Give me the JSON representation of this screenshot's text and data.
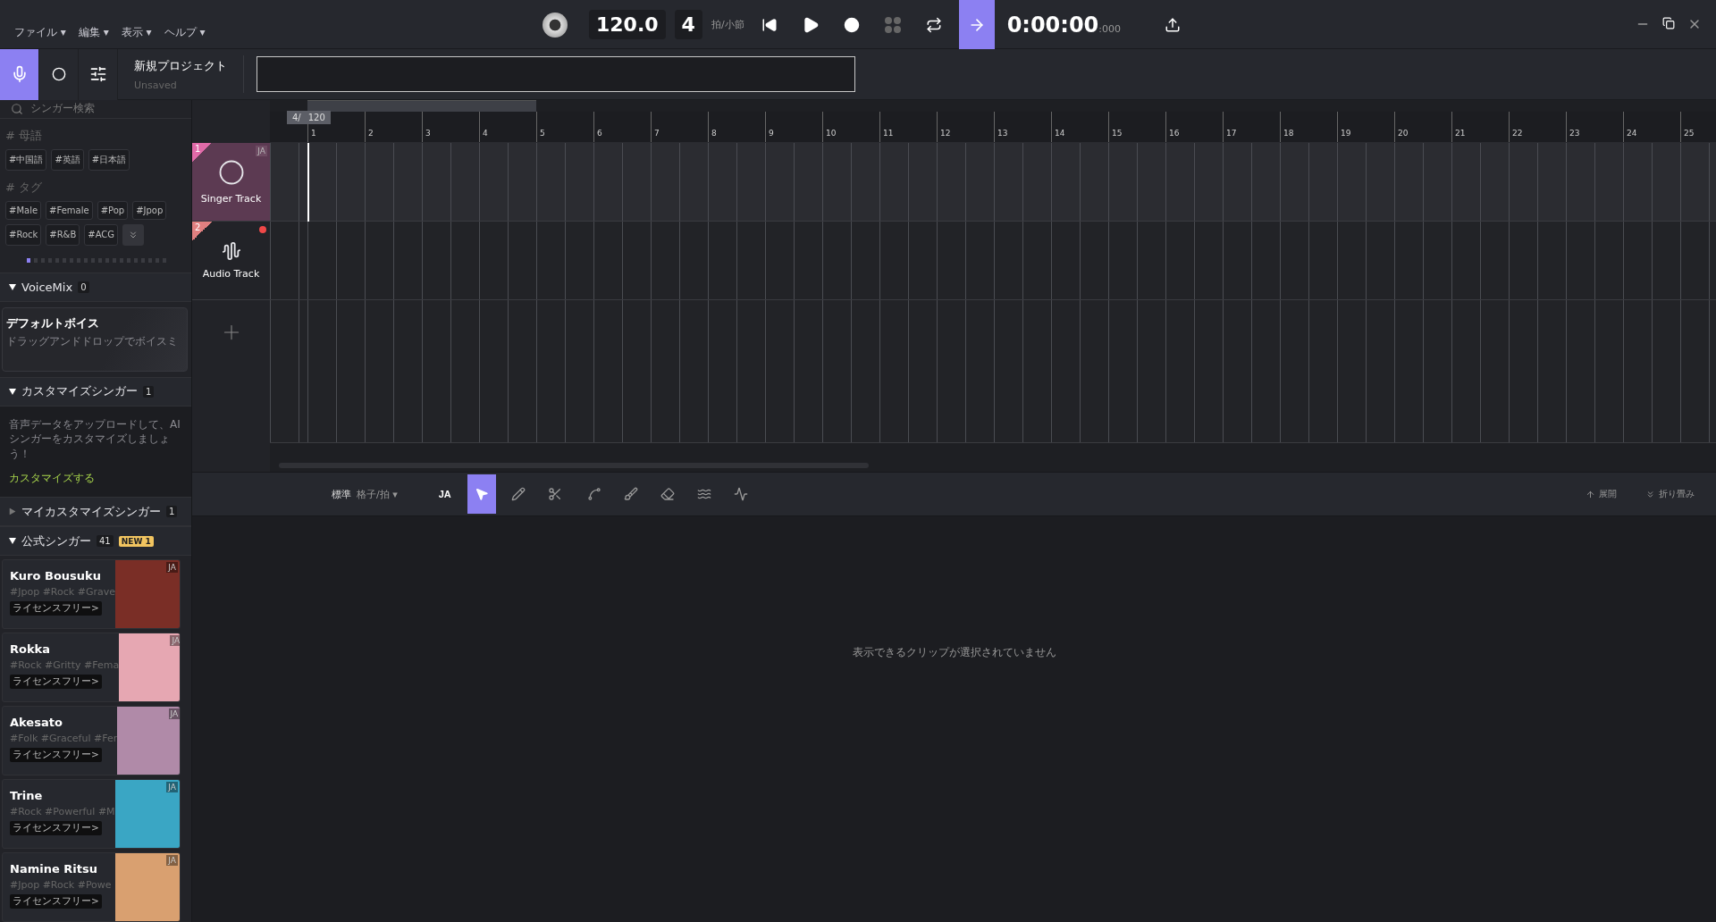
{
  "menu": [
    {
      "label": "ファイル",
      "caret": "▾"
    },
    {
      "label": "編集",
      "caret": "▾"
    },
    {
      "label": "表示",
      "caret": "▾"
    },
    {
      "label": "ヘルプ",
      "caret": "▾"
    }
  ],
  "transport": {
    "tempo": "120.0",
    "beats": "4",
    "beats_unit": "拍/小節",
    "time": "0:00:00",
    "time_ms": ":000",
    "follow_on": true
  },
  "sidebar_tabs": [
    {
      "kind": "microphone",
      "selected": true
    },
    {
      "kind": "avatar",
      "selected": false
    },
    {
      "kind": "sliders",
      "selected": false
    }
  ],
  "project": {
    "name": "新規プロジェクト",
    "status": "Unsaved"
  },
  "sidebar": {
    "search": {
      "placeholder": "シンガー検索"
    },
    "language_heading": "# 母語",
    "languages": [
      "#中国語",
      "#英語",
      "#日本語"
    ],
    "tag_heading": "# タグ",
    "tags": [
      "#Male",
      "#Female",
      "#Pop",
      "#Jpop",
      "#Rock",
      "#R&B",
      "#ACG"
    ],
    "sections": [
      {
        "kind": "voicemix",
        "title": "VoiceMix",
        "count": "0",
        "expanded": true,
        "card": {
          "title": "デフォルトボイス",
          "text": "ドラッグアンドドロップでボイスミ"
        }
      },
      {
        "kind": "custom",
        "title": "カスタマイズシンガー",
        "count": "1",
        "expanded": true,
        "text": "音声データをアップロードして、AIシンガーをカスタマイズしましょう！",
        "link": "カスタマイズする"
      },
      {
        "kind": "mine",
        "title": "マイカスタマイズシンガー",
        "count": "1",
        "expanded": false
      },
      {
        "kind": "official",
        "title": "公式シンガー",
        "count": "41",
        "badge": "NEW 1",
        "expanded": true,
        "singers": [
          {
            "name": "Kuro Bousuku",
            "tags": "#Jpop #Rock #Grave",
            "license": "ライセンスフリー>",
            "lang": "JA",
            "color": "#7a2e26"
          },
          {
            "name": "Rokka",
            "tags": "#Rock #Gritty #Fema",
            "license": "ライセンスフリー>",
            "lang": "JA",
            "color": "#e6a7b2"
          },
          {
            "name": "Akesato",
            "tags": "#Folk #Graceful #Fer",
            "license": "ライセンスフリー>",
            "lang": "JA",
            "color": "#b08aa8"
          },
          {
            "name": "Trine",
            "tags": "#Rock #Powerful #M",
            "license": "ライセンスフリー>",
            "lang": "JA",
            "color": "#3aa6c4"
          },
          {
            "name": "Namine Ritsu",
            "tags": "#Jpop #Rock #Powe",
            "license": "ライセンスフリー>",
            "lang": "JA",
            "color": "#d9a070"
          }
        ]
      }
    ]
  },
  "loop_marker": {
    "signature": "4/",
    "tempo": "120"
  },
  "ruler": [
    "1",
    "2",
    "3",
    "4",
    "5",
    "6",
    "7",
    "8",
    "9",
    "10",
    "11",
    "12",
    "13",
    "14",
    "15",
    "16",
    "17",
    "18",
    "19",
    "20",
    "21",
    "22",
    "23",
    "24",
    "25"
  ],
  "tracks": [
    {
      "kind": "singer",
      "number": "1",
      "name": "Singer Track",
      "lang": "JA",
      "selected": true
    },
    {
      "kind": "audio",
      "number": "2",
      "name": "Audio Track",
      "selected": false,
      "armed": true
    }
  ],
  "editor_toolbar": {
    "mode": "標準",
    "grid": "格子/拍",
    "grid_caret": "▾",
    "lang": "JA",
    "tools": [
      {
        "kind": "select",
        "selected": true
      },
      {
        "kind": "pencil",
        "selected": false
      },
      {
        "kind": "scissors",
        "selected": false
      },
      {
        "kind": "curve",
        "selected": false
      },
      {
        "kind": "brush",
        "selected": false
      },
      {
        "kind": "eraser",
        "selected": false
      },
      {
        "kind": "vibrato",
        "selected": false
      },
      {
        "kind": "transition",
        "selected": false
      }
    ],
    "expand": "展開",
    "collapse": "折り畳み"
  },
  "editor_message": "表示できるクリップが選択されていません"
}
